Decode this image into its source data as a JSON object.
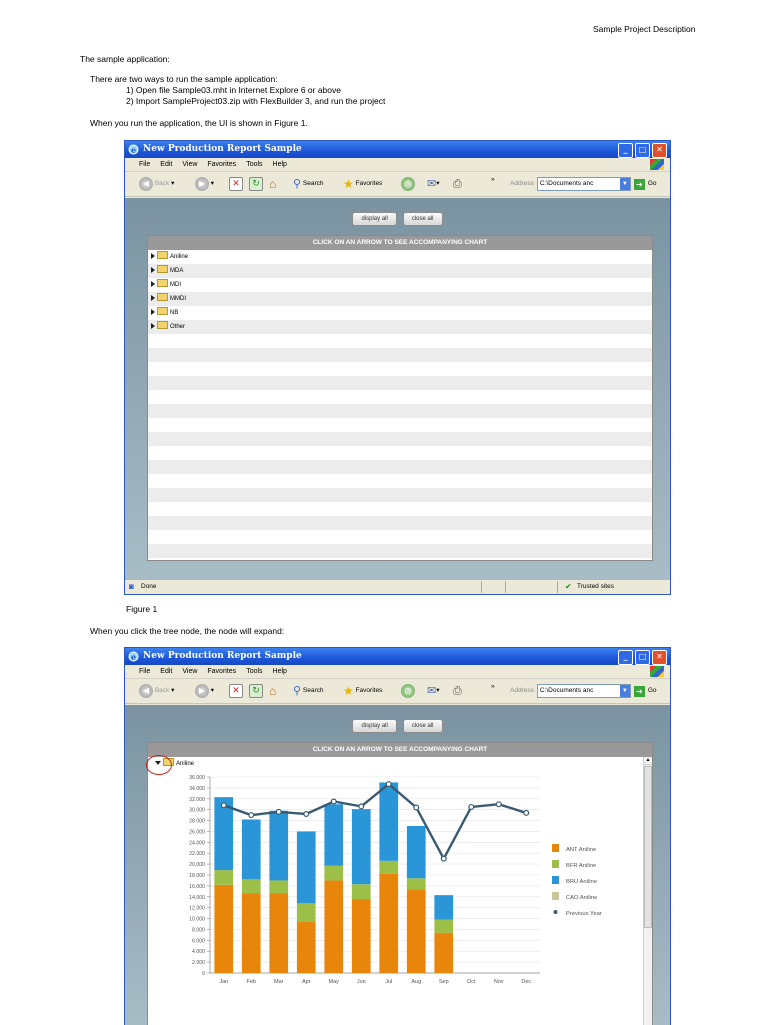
{
  "doc": {
    "header": "Sample Project Description",
    "intro": "The sample application:",
    "ways_title": "There are two ways to run the sample application:",
    "way1": "1) Open file Sample03.mht in Internet Explore 6 or above",
    "way2": "2) Import SampleProject03.zip with FlexBuilder 3, and run the project",
    "ui_sentence": "When you run the application, the UI is shown in Figure 1.",
    "figure1_caption": "Figure 1",
    "expand_sentence": "When you click the tree node, the node will expand:"
  },
  "window": {
    "title": "New Production Report Sample",
    "menu": [
      "File",
      "Edit",
      "View",
      "Favorites",
      "Tools",
      "Help"
    ],
    "toolbar": {
      "back": "Back",
      "search": "Search",
      "favorites": "Favorites",
      "more": "»",
      "address_label": "Address",
      "address_value": "C:\\Documents anc",
      "go": "Go"
    },
    "status_left": "Done",
    "status_zone": "Trusted sites"
  },
  "app": {
    "display_all": "display all",
    "close_all": "close all",
    "header": "CLICK ON AN ARROW TO SEE ACCOMPANYING CHART",
    "tree_items": [
      "Aniline",
      "MDA",
      "MDI",
      "MMDI",
      "NB",
      "Other"
    ],
    "expanded_item": "Aniline"
  },
  "colors": {
    "ant": "#e8860c",
    "bfr": "#9cbf48",
    "bru": "#2a96d8",
    "cao": "#c9c79a",
    "prev": "#3a5a72"
  },
  "chart_data": {
    "type": "bar",
    "stacked": true,
    "categories": [
      "Jan",
      "Feb",
      "Mar",
      "Apr",
      "May",
      "Jun",
      "Jul",
      "Aug",
      "Sep",
      "Oct",
      "Nov",
      "Dec"
    ],
    "ylim": [
      0,
      36000
    ],
    "y_ticks": [
      "0",
      "2.000",
      "4.000",
      "6.000",
      "8.000",
      "10.000",
      "12.000",
      "14.000",
      "16.000",
      "18.000",
      "20.000",
      "22.000",
      "24.000",
      "26.000",
      "28.000",
      "30.000",
      "32.000",
      "34.000",
      "36.000"
    ],
    "series": [
      {
        "name": "ANT Aniline",
        "values": [
          16200,
          14600,
          14600,
          9500,
          17000,
          13500,
          18200,
          15400,
          7400,
          0,
          0,
          0
        ]
      },
      {
        "name": "BFR Aniline",
        "values": [
          2700,
          2600,
          2400,
          3300,
          2700,
          2800,
          2400,
          2000,
          2400,
          0,
          0,
          0
        ]
      },
      {
        "name": "BRU Aniline",
        "values": [
          13400,
          11000,
          12800,
          13200,
          11300,
          13800,
          14400,
          9600,
          4500,
          0,
          0,
          0
        ]
      },
      {
        "name": "CAO Aniline",
        "values": [
          0,
          0,
          0,
          0,
          0,
          0,
          0,
          0,
          0,
          0,
          0,
          0
        ]
      }
    ],
    "line_series": {
      "name": "Previous Year",
      "values": [
        30800,
        29000,
        29600,
        29200,
        31500,
        30600,
        34700,
        30400,
        21000,
        30500,
        31000,
        29400
      ]
    },
    "legend_position": "right",
    "grid": true
  }
}
